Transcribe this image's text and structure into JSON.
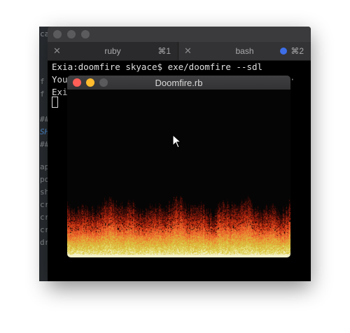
{
  "terminal": {
    "tabs": [
      {
        "label": "ruby",
        "shortcut": "⌘1",
        "close_icon": "close-icon"
      },
      {
        "label": "bash",
        "shortcut": "⌘2",
        "close_icon": "close-icon",
        "dot_color": "#3d6ee8"
      }
    ],
    "lines": [
      "Exia:doomfire skyace$ exe/doomfire --sdl",
      "You",
      "Exi"
    ],
    "right_fragment": "·"
  },
  "editor_fragments": [
    "ca",
    "f",
    "f",
    "##",
    "SHE",
    "##",
    "ap",
    "po",
    "sh",
    "cr",
    "cr",
    "cr",
    "dr"
  ],
  "doomfire_window": {
    "title": "Doomfire.rb",
    "traffic_lights": {
      "close": "#ff5f57",
      "minimize": "#febc2e",
      "zoom": "#5a5a5c"
    }
  },
  "colors": {
    "fire_top": "#a31f0d",
    "fire_mid": "#e8562a",
    "fire_low": "#d9c23f",
    "fire_base": "#f4f1c8"
  }
}
